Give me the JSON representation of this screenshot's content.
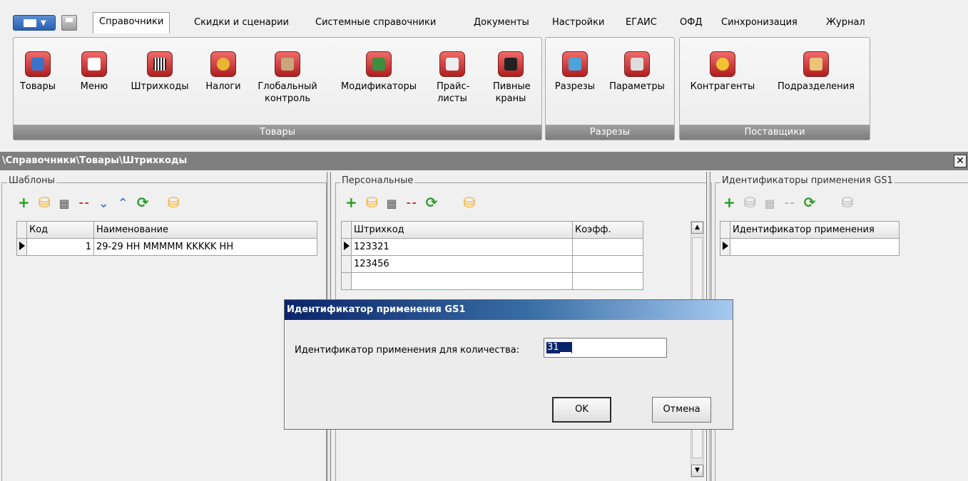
{
  "menu": {
    "tabs": [
      "Справочники",
      "Скидки и сценарии",
      "Системные справочники",
      "Документы",
      "Настройки",
      "ЕГАИС",
      "ОФД",
      "Синхронизация",
      "Журнал"
    ],
    "active_tab": "Справочники"
  },
  "ribbon": {
    "groups": [
      {
        "label": "Товары",
        "buttons": [
          {
            "label": "Товары",
            "icon": "bottle-icon"
          },
          {
            "label": "Меню",
            "icon": "menu-book-icon"
          },
          {
            "label": "Штрихкоды",
            "icon": "barcode-icon"
          },
          {
            "label": "Налоги",
            "icon": "coins-icon"
          },
          {
            "label": "Глобальный контроль",
            "icon": "tools-box-icon"
          },
          {
            "label": "Модификаторы",
            "icon": "bottle-glass-icon"
          },
          {
            "label": "Прайс-листы",
            "icon": "price-list-icon"
          },
          {
            "label": "Пивные краны",
            "icon": "beer-tap-icon"
          }
        ]
      },
      {
        "label": "Разрезы",
        "buttons": [
          {
            "label": "Разрезы",
            "icon": "cubes-icon"
          },
          {
            "label": "Параметры",
            "icon": "tools-icon"
          }
        ]
      },
      {
        "label": "Поставщики",
        "buttons": [
          {
            "label": "Контрагенты",
            "icon": "worker-icon"
          },
          {
            "label": "Подразделения",
            "icon": "store-icon"
          }
        ]
      }
    ]
  },
  "path": "\\Справочники\\Товары\\Штрихкоды",
  "panels": {
    "templates": {
      "title": "Шаблоны",
      "columns": [
        "Код",
        "Наименование"
      ],
      "rows": [
        [
          "1",
          "29-29 НН ММММM KKKKK НН"
        ]
      ]
    },
    "personal": {
      "title": "Персональные",
      "columns": [
        "Штрихкод",
        "Коэфф."
      ],
      "rows": [
        [
          "123321",
          ""
        ],
        [
          "123456",
          ""
        ],
        [
          "",
          ""
        ]
      ]
    },
    "gs1": {
      "title": "Идентификаторы применения GS1",
      "columns": [
        "Идентификатор применения"
      ],
      "rows": [
        [
          ""
        ]
      ]
    }
  },
  "dialog": {
    "title": "Идентификатор применения GS1",
    "label": "Идентификатор применения для количества:",
    "value": "31",
    "ok": "OK",
    "cancel": "Отмена"
  },
  "colors": {
    "dialog_title_start": "#0a246a",
    "dialog_title_end": "#a6caf0",
    "group_label_bg": "#7d7d7d",
    "path_bar_bg": "#7f7f7f"
  }
}
